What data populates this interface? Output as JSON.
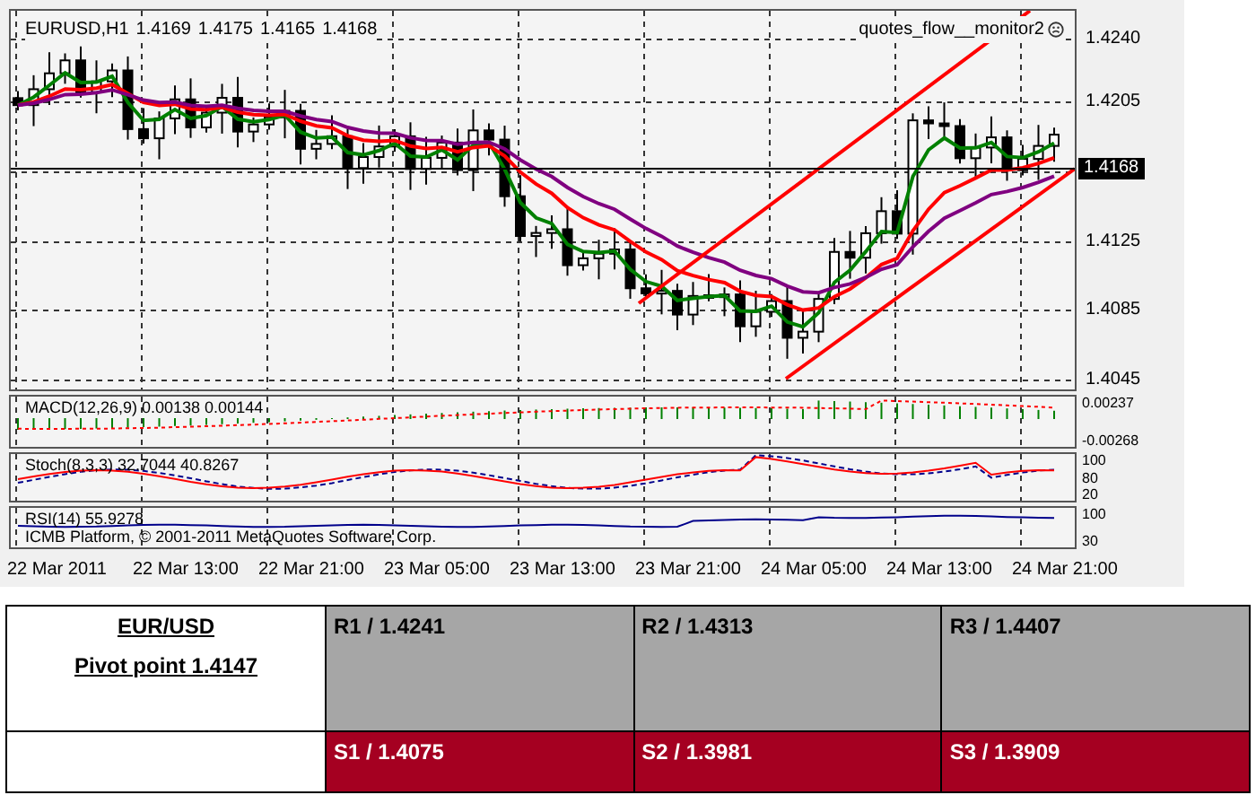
{
  "chart": {
    "symbol": "EURUSD,H1",
    "ohlc": [
      "1.4169",
      "1.4175",
      "1.4165",
      "1.4168"
    ],
    "indicator_name": "quotes_flow__monitor2",
    "price_labels": [
      "1.4240",
      "1.4205",
      "1.4125",
      "1.4085",
      "1.4045"
    ],
    "current_price": "1.4168",
    "time_labels": [
      "22 Mar 2011",
      "22 Mar 13:00",
      "22 Mar 21:00",
      "23 Mar 05:00",
      "23 Mar 13:00",
      "23 Mar 21:00",
      "24 Mar 05:00",
      "24 Mar 13:00",
      "24 Mar 21:00"
    ],
    "copyright": "ICMB Platform, © 2001-2011 MetaQuotes Software Corp."
  },
  "panes": [
    {
      "kind": "macd",
      "label": "MACD(12,26,9) 0.00138 0.00144",
      "scale": [
        "0.00237",
        "-0.00268"
      ]
    },
    {
      "kind": "stoch",
      "label": "Stoch(8,3,3) 32.7044 40.8267",
      "scale": [
        "100",
        "80",
        "20"
      ]
    },
    {
      "kind": "rsi",
      "label": "RSI(14) 55.9278",
      "scale": [
        "100",
        "30"
      ]
    }
  ],
  "pivot_table": {
    "title": "EUR/USD",
    "pivot": "Pivot point 1.4147",
    "resistance": [
      "R1 / 1.4241",
      "R2 / 1.4313",
      "R3 / 1.4407"
    ],
    "support": [
      "S1 / 1.4075",
      "S2 / 1.3981",
      "S3 / 1.3909"
    ]
  }
}
